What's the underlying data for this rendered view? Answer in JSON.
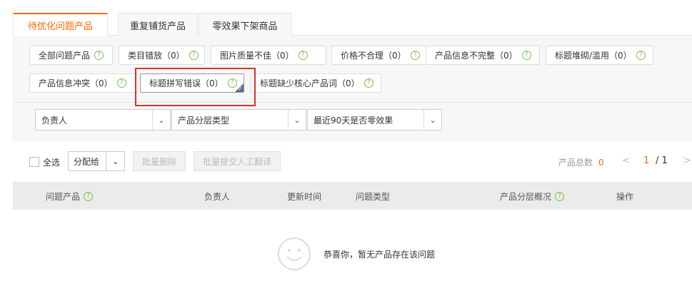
{
  "tabs": [
    {
      "label": "待优化问题产品",
      "active": true
    },
    {
      "label": "重复铺货产品",
      "active": false
    },
    {
      "label": "零效果下架商品",
      "active": false
    }
  ],
  "chips_row1": [
    {
      "label": "全部问题产品"
    },
    {
      "label": "类目错放（0）"
    },
    {
      "label": "图片质量不佳（0）"
    },
    {
      "label": "价格不合理（0）"
    },
    {
      "label": "产品信息不完整（0）"
    },
    {
      "label": "标题堆砌/滥用（0）"
    }
  ],
  "chips_row2": [
    {
      "label": "产品信息冲突（0）"
    },
    {
      "label": "标题拼写错误（0）",
      "selected": true
    },
    {
      "label": "标题缺少核心产品词（0）"
    }
  ],
  "help_glyph": "?",
  "selects": [
    {
      "value": "负责人"
    },
    {
      "value": "产品分层类型"
    },
    {
      "value": "最近90天是否零效果"
    }
  ],
  "toolbar": {
    "select_all": "全选",
    "assign": "分配给",
    "batch_delete": "批量删除",
    "batch_translate": "批量提交人工翻译",
    "total_label": "产品总数",
    "total_count": "0",
    "current_page": "1",
    "total_pages": "/ 1"
  },
  "table": {
    "columns": [
      "问题产品",
      "负责人",
      "更新时间",
      "问题类型",
      "产品分层概况",
      "操作"
    ]
  },
  "empty_message": "恭喜你，暂无产品存在该问题",
  "colors": {
    "accent": "#ff6a00",
    "help": "#7bbf4d",
    "highlight": "#d9342b"
  }
}
